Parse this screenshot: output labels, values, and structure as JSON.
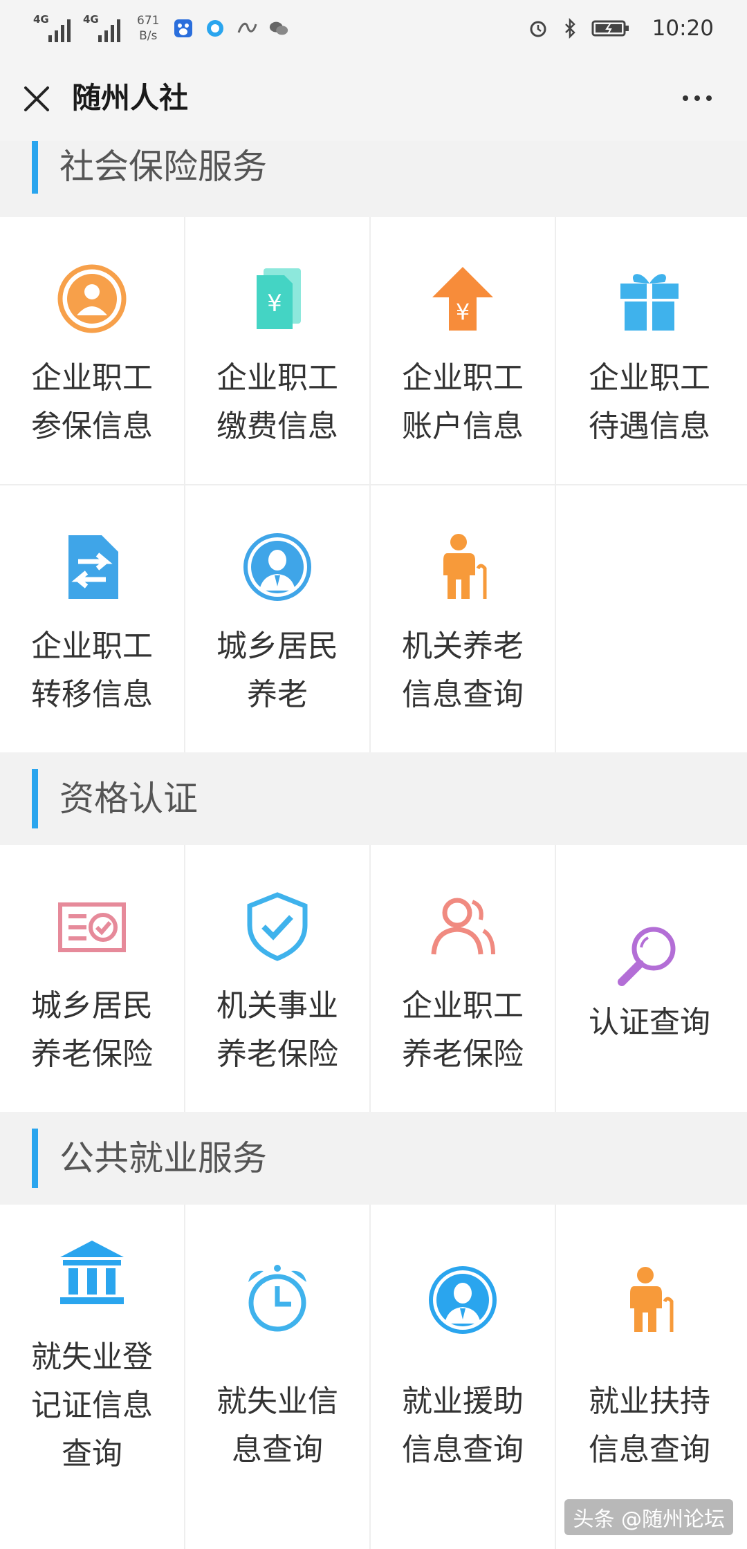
{
  "status_bar": {
    "network_1": "4G",
    "network_2": "4G",
    "speed_value": "671",
    "speed_unit": "B/s",
    "time": "10:20",
    "icons": [
      "signal-icon",
      "baidu-icon",
      "browser-icon",
      "xuexi-icon",
      "wechat-icon",
      "alarm-icon",
      "bluetooth-icon",
      "battery-icon"
    ]
  },
  "header": {
    "title": "随州人社"
  },
  "sections": [
    {
      "title": "社会保险服务",
      "rows": [
        [
          {
            "lines": [
              "企业职工",
              "参保信息"
            ],
            "icon": "person-circle-icon",
            "color": "#f7a04a"
          },
          {
            "lines": [
              "企业职工",
              "缴费信息"
            ],
            "icon": "yuan-document-icon",
            "color": "#44d4c4"
          },
          {
            "lines": [
              "企业职工",
              "账户信息"
            ],
            "icon": "yuan-arrow-icon",
            "color": "#f78c3a"
          },
          {
            "lines": [
              "企业职工",
              "待遇信息"
            ],
            "icon": "gift-icon",
            "color": "#3fb2ec"
          }
        ],
        [
          {
            "lines": [
              "企业职工",
              "转移信息"
            ],
            "icon": "transfer-document-icon",
            "color": "#3fa5e8"
          },
          {
            "lines": [
              "城乡居民",
              "养老"
            ],
            "icon": "resident-avatar-icon",
            "color": "#3fa5e8"
          },
          {
            "lines": [
              "机关养老",
              "信息查询"
            ],
            "icon": "elderly-person-icon",
            "color": "#f79a3a"
          }
        ]
      ]
    },
    {
      "title": "资格认证",
      "rows": [
        [
          {
            "lines": [
              "城乡居民",
              "养老保险"
            ],
            "icon": "certificate-icon",
            "color": "#e68a9a"
          },
          {
            "lines": [
              "机关事业",
              "养老保险"
            ],
            "icon": "shield-check-icon",
            "color": "#3fb2ec"
          },
          {
            "lines": [
              "企业职工",
              "养老保险"
            ],
            "icon": "users-icon",
            "color": "#f08a80"
          },
          {
            "lines": [
              "认证查询"
            ],
            "icon": "magnifier-icon",
            "color": "#b36ed6"
          }
        ]
      ]
    },
    {
      "title": "公共就业服务",
      "rows": [
        [
          {
            "lines": [
              "就失业登",
              "记证信息",
              "查询"
            ],
            "icon": "bank-building-icon",
            "color": "#2aa5ee"
          },
          {
            "lines": [
              "就失业信",
              "息查询"
            ],
            "icon": "alarm-clock-icon",
            "color": "#3fb2ec"
          },
          {
            "lines": [
              "就业援助",
              "信息查询"
            ],
            "icon": "worker-avatar-icon",
            "color": "#2aa5ee"
          },
          {
            "lines": [
              "就业扶持",
              "信息查询"
            ],
            "icon": "elderly-person-icon",
            "color": "#f79a3a"
          }
        ]
      ]
    }
  ],
  "watermark": "头条 @随州论坛"
}
